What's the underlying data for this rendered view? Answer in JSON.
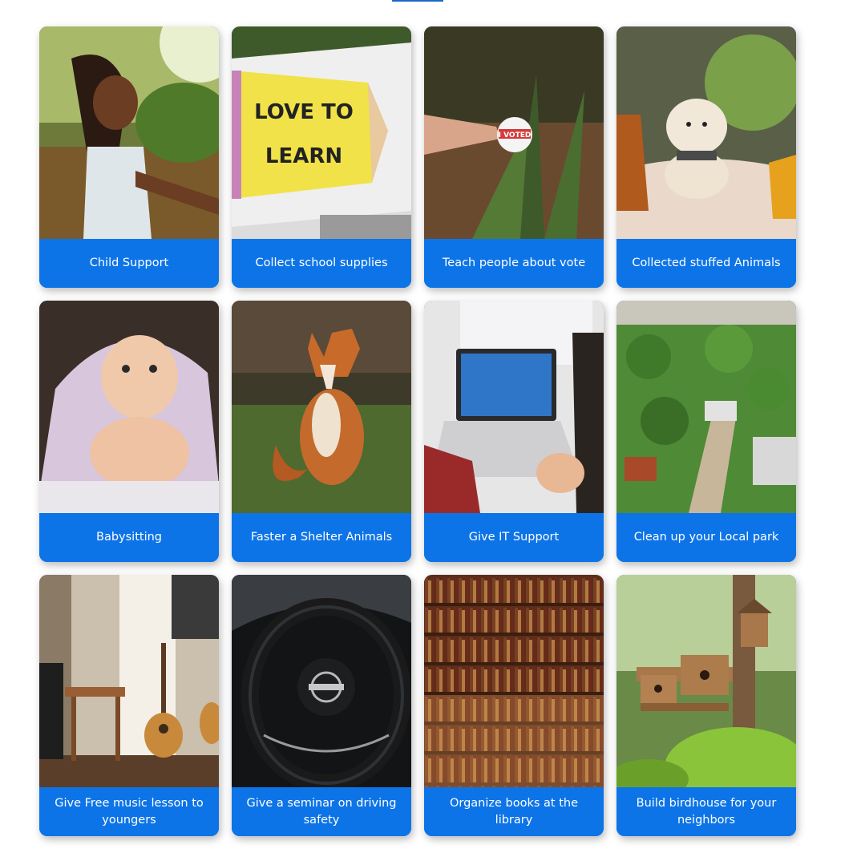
{
  "cards": [
    {
      "label": "Child Support",
      "image": "girl-outdoors-photo"
    },
    {
      "label": "Collect school supplies",
      "image": "love-to-learn-pencil-photo",
      "image_text": "LOVE TO LEARN"
    },
    {
      "label": "Teach people about vote",
      "image": "i-voted-sticker-photo",
      "image_text": "I VOTED"
    },
    {
      "label": "Collected stuffed Animals",
      "image": "poodle-dog-photo"
    },
    {
      "label": "Babysitting",
      "image": "baby-under-blanket-photo"
    },
    {
      "label": "Faster a Shelter Animals",
      "image": "fox-in-grass-photo"
    },
    {
      "label": "Give IT Support",
      "image": "laptop-typing-photo"
    },
    {
      "label": "Clean up your Local park",
      "image": "city-park-aerial-photo"
    },
    {
      "label": "Give Free music lesson to youngers",
      "image": "guitar-room-photo"
    },
    {
      "label": "Give a seminar on driving safety",
      "image": "steering-wheel-photo"
    },
    {
      "label": "Organize books at the library",
      "image": "library-bookshelf-photo"
    },
    {
      "label": "Build birdhouse for your neighbors",
      "image": "birdhouse-tree-photo"
    }
  ],
  "colors": {
    "accent": "#0d74e8",
    "label_text": "#ffffff"
  }
}
